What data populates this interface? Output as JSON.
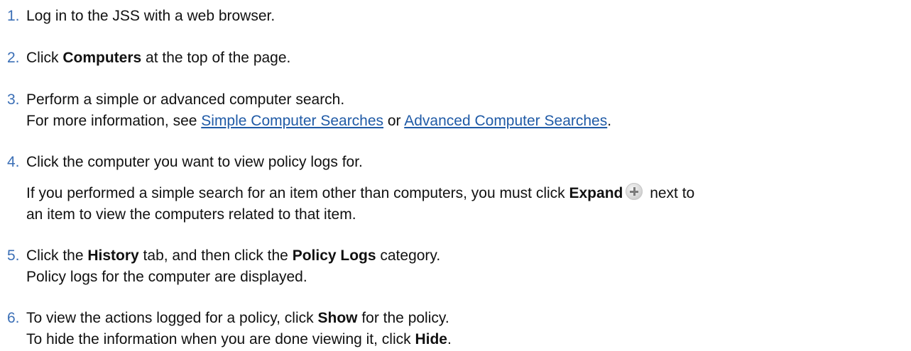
{
  "steps": [
    {
      "number": "1.",
      "text": "Log in to the JSS with a web browser."
    },
    {
      "number": "2.",
      "pre": "Click ",
      "bold": "Computers",
      "post": " at the top of the page."
    },
    {
      "number": "3.",
      "line1": "Perform a simple or advanced computer search.",
      "line2_pre": "For more information, see ",
      "link1": "Simple Computer Searches",
      "line2_mid": " or ",
      "link2": "Advanced Computer Searches",
      "line2_post": "."
    },
    {
      "number": "4.",
      "line1": "Click the computer you want to view policy logs for.",
      "line2_pre": "If you performed a simple search for an item other than computers, you must click ",
      "bold": "Expand",
      "line2_post": " next to",
      "line3": "an item to view the computers related to that item."
    },
    {
      "number": "5.",
      "pre": "Click the ",
      "bold1": "History",
      "mid": " tab, and then click the ",
      "bold2": "Policy Logs",
      "post": " category.",
      "line2": "Policy logs for the computer are displayed."
    },
    {
      "number": "6.",
      "pre": "To view the actions logged for a policy, click ",
      "bold1": "Show",
      "post": " for the policy.",
      "line2_pre": "To hide the information when you are done viewing it, click ",
      "bold2": "Hide",
      "line2_post": "."
    }
  ],
  "icons": {
    "expand": "plus-circle-icon"
  },
  "colors": {
    "step_number": "#3b6fb6",
    "link": "#1f5aa6",
    "text": "#111111"
  }
}
